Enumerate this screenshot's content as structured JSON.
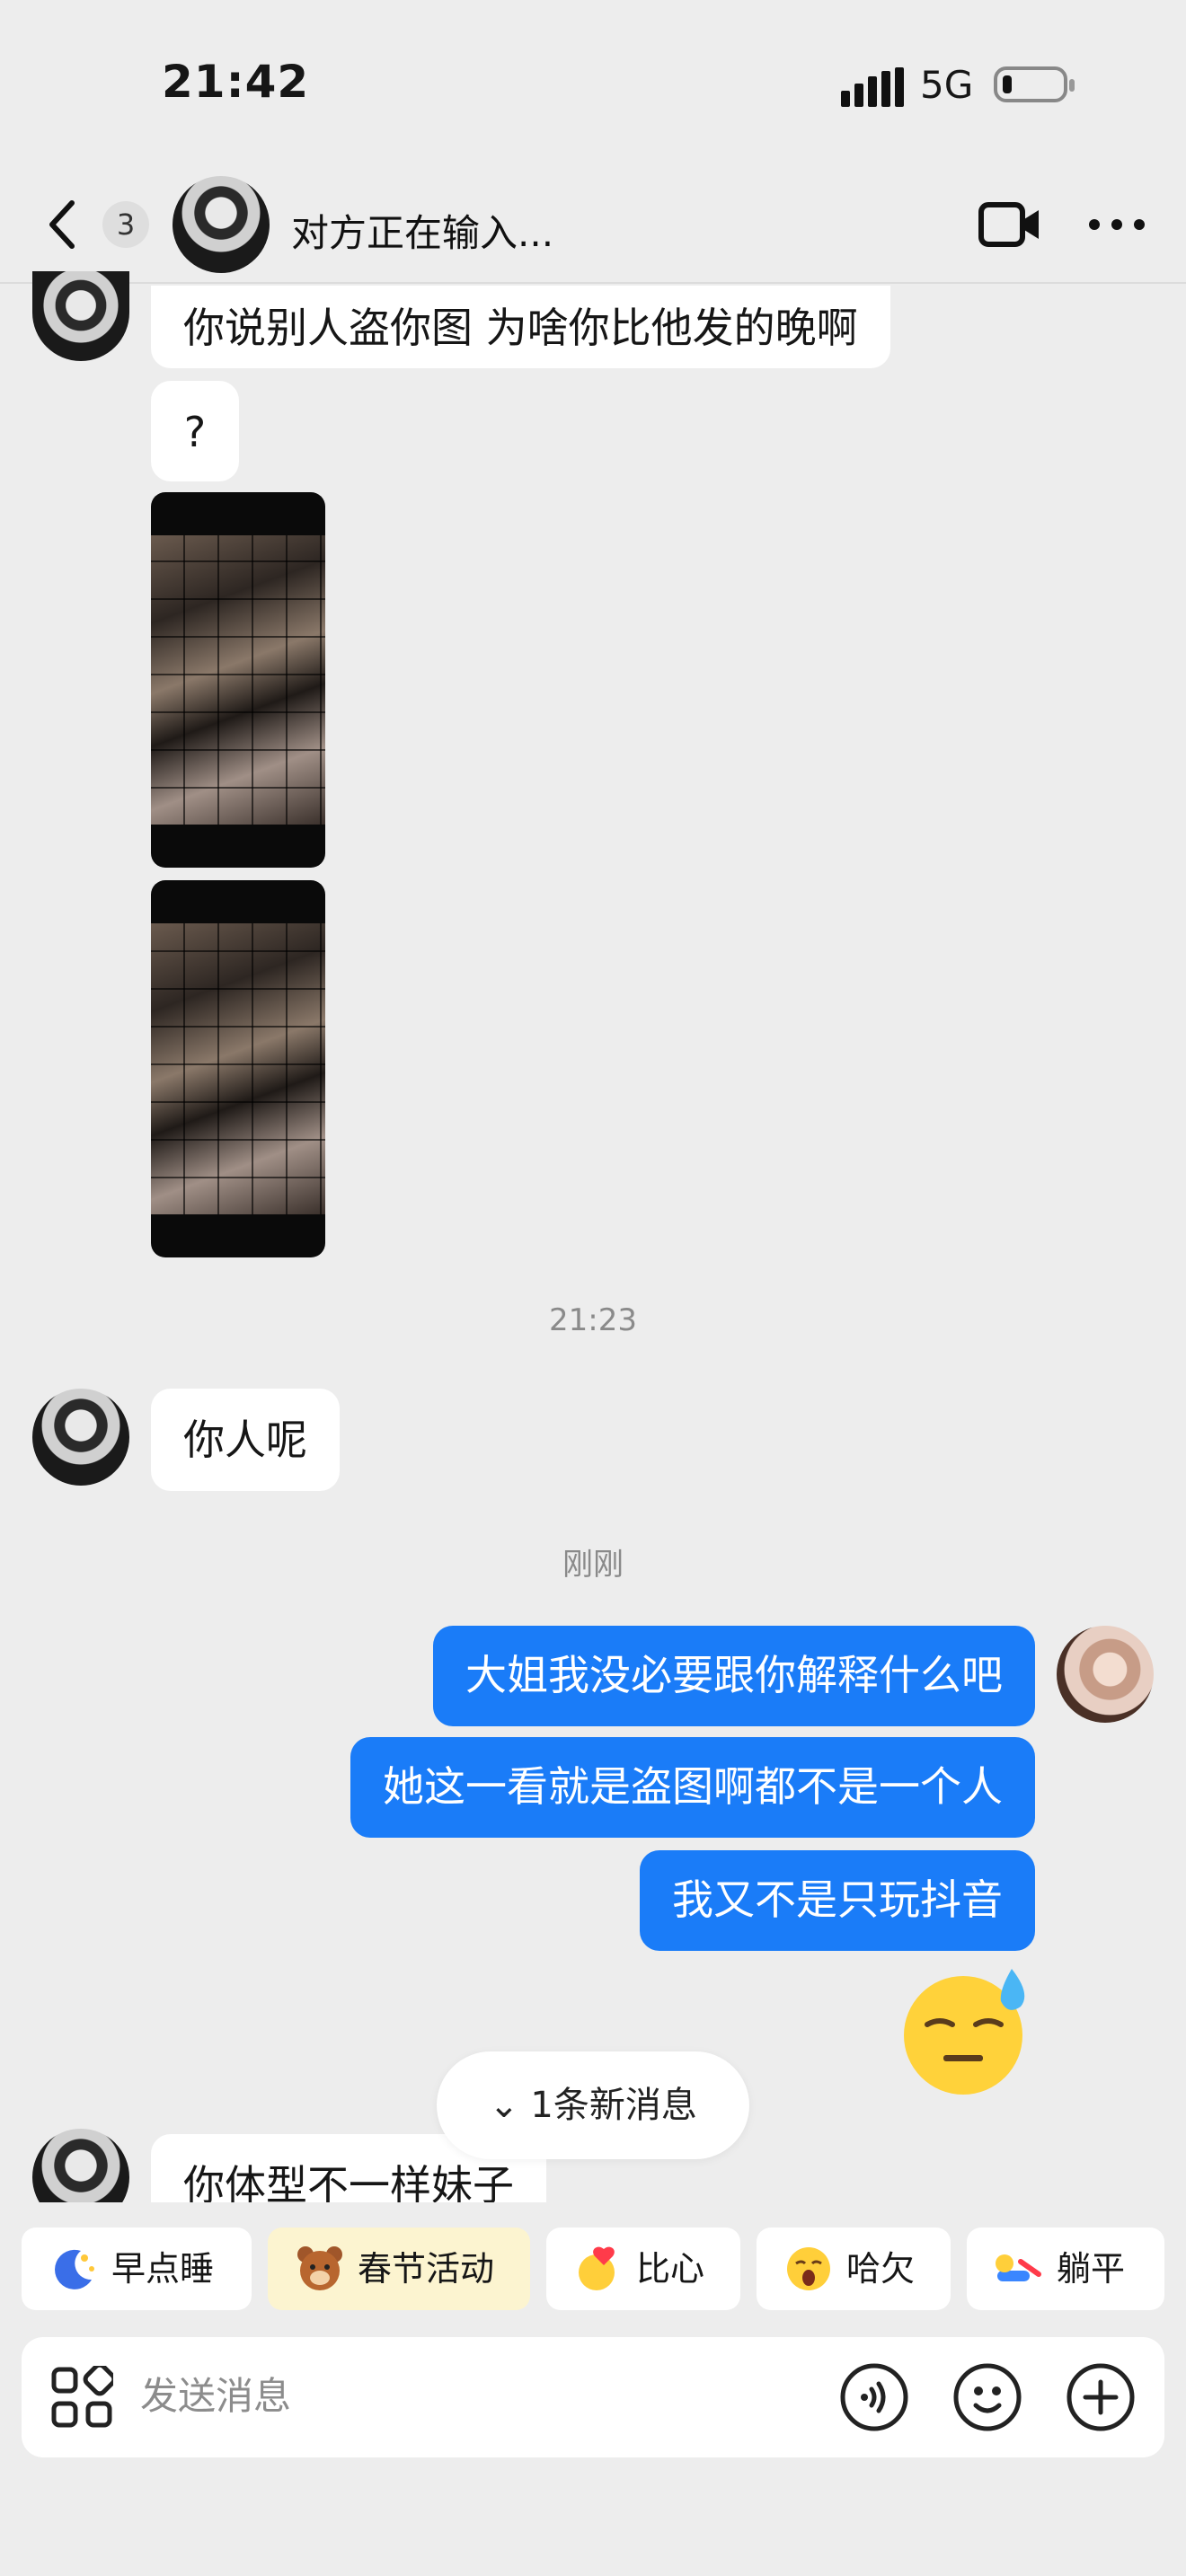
{
  "status": {
    "time": "21:42",
    "network": "5G"
  },
  "header": {
    "unread_count": "3",
    "title": "对方正在输入..."
  },
  "messages": {
    "m1": "你说别人盗你图 为啥你比他发的晚啊",
    "m2": "?",
    "time1": "21:23",
    "m3": "你人呢",
    "time2": "刚刚",
    "out1": "大姐我没必要跟你解释什么吧",
    "out2": "她这一看就是盗图啊都不是一个人",
    "out3": "我又不是只玩抖音",
    "m4": "你体型不一样妹子"
  },
  "new_messages": "1条新消息",
  "quick_replies": [
    {
      "label": "早点睡",
      "icon": "moon-sleep-icon"
    },
    {
      "label": "春节活动",
      "icon": "bear-icon"
    },
    {
      "label": "比心",
      "icon": "heart-hands-icon"
    },
    {
      "label": "哈欠",
      "icon": "yawn-icon"
    },
    {
      "label": "躺平",
      "icon": "lie-flat-icon"
    }
  ],
  "input": {
    "placeholder": "发送消息"
  },
  "colors": {
    "accent": "#1a7cf8",
    "background": "#ededed",
    "bubble_in": "#ffffff",
    "highlight": "#fcf4d0"
  }
}
